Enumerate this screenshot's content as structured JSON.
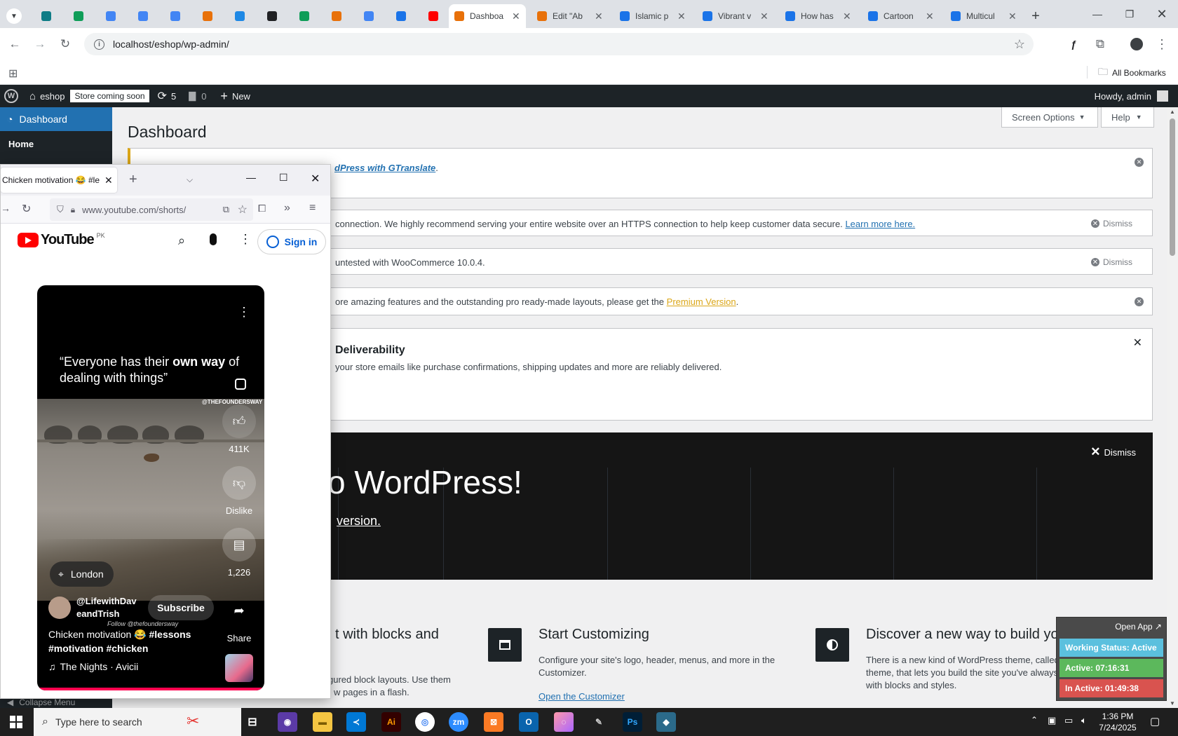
{
  "browser": {
    "tabs": [
      {
        "title": "",
        "color": "#0e7c86"
      },
      {
        "title": "",
        "color": "#0f9d58"
      },
      {
        "title": "",
        "color": "#4285f4"
      },
      {
        "title": "",
        "color": "#4285f4"
      },
      {
        "title": "",
        "color": "#4285f4"
      },
      {
        "title": "",
        "color": "#e8710a"
      },
      {
        "title": "",
        "color": "#1e88e5"
      },
      {
        "title": "",
        "color": "#202124"
      },
      {
        "title": "",
        "color": "#0f9d58"
      },
      {
        "title": "",
        "color": "#e8710a"
      },
      {
        "title": "",
        "color": "#4285f4"
      },
      {
        "title": "",
        "color": "#1a73e8"
      },
      {
        "title": "",
        "color": "#ff0000"
      }
    ],
    "named_tabs": [
      {
        "title": "Dashboa",
        "color": "#e8710a"
      },
      {
        "title": "Edit \"Ab",
        "color": "#e8710a"
      },
      {
        "title": "Islamic p",
        "color": "#1a73e8"
      },
      {
        "title": "Vibrant v",
        "color": "#1a73e8"
      },
      {
        "title": "How has",
        "color": "#1a73e8"
      },
      {
        "title": "Cartoon",
        "color": "#1a73e8"
      },
      {
        "title": "Multicul",
        "color": "#1a73e8"
      }
    ],
    "url": "localhost/eshop/wp-admin/",
    "all_bookmarks": "All Bookmarks"
  },
  "adminbar": {
    "site_name": "eshop",
    "store_badge": "Store coming soon",
    "updates_count": "5",
    "comments_count": "0",
    "new_label": "New",
    "howdy": "Howdy, admin"
  },
  "sidebar": {
    "dashboard": "Dashboard",
    "home": "Home",
    "collapse": "Collapse Menu"
  },
  "main": {
    "title": "Dashboard",
    "screen_options": "Screen Options",
    "help": "Help",
    "notices": [
      {
        "text": "dPress with GTranslate",
        "suffix": "."
      },
      {
        "text": "connection. We highly recommend serving your entire website over an HTTPS connection to help keep customer data secure.",
        "link": "Learn more here.",
        "dismiss": "Dismiss"
      },
      {
        "text": "untested with WooCommerce 10.0.4.",
        "dismiss": "Dismiss"
      },
      {
        "text": "ore amazing features and the outstanding pro ready-made layouts, please get the",
        "link": "Premium Version",
        "suffix": "."
      },
      {
        "title": "Deliverability",
        "text": "your store emails like purchase confirmations, shipping updates and more are reliably delivered."
      }
    ],
    "welcome": {
      "title": "o WordPress!",
      "sub": "version.",
      "dismiss": "Dismiss"
    },
    "panels": [
      {
        "title": "t with blocks and",
        "text": "gured block layouts. Use them",
        "text2": "w pages in a flash."
      },
      {
        "title": "Start Customizing",
        "text": "Configure your site's logo, header, menus, and more in the Customizer.",
        "link": "Open the Customizer"
      },
      {
        "title": "Discover a new way to build your site.",
        "text": "There is a new kind of WordPress theme, called a block theme, that lets you build the site you've always wanted — with blocks and styles."
      }
    ]
  },
  "firefox": {
    "tab_title": "Chicken motivation 😂 #le",
    "url": "www.youtube.com/shorts/",
    "youtube": {
      "region": "PK",
      "logo": "YouTube",
      "sign_in": "Sign in",
      "quote_a": "“Everyone has their ",
      "quote_b": "own way",
      "quote_c": " of dealing with things”",
      "watermark": "@THEFOUNDERSWAY",
      "likes": "411K",
      "dislike": "Dislike",
      "comments": "1,226",
      "share": "Share",
      "location": "London",
      "channel": "@LifewithDav eandTrish",
      "subscribe": "Subscribe",
      "follow": "Follow @thefoundersway",
      "caption_a": "Chicken motivation 😂 ",
      "caption_b": "#lessons #motivation #chicken",
      "music": "The Nights · Avicii"
    }
  },
  "widget": {
    "open_app": "Open App ↗",
    "status": "Working Status: Active",
    "active": "Active: 07:16:31",
    "inactive": "In Active: 01:49:38",
    "status_color": "#5bc0de",
    "active_color": "#5cb85c",
    "inactive_color": "#d9534f"
  },
  "taskbar": {
    "search": "Type here to search",
    "time": "1:36 PM",
    "date": "7/24/2025"
  }
}
